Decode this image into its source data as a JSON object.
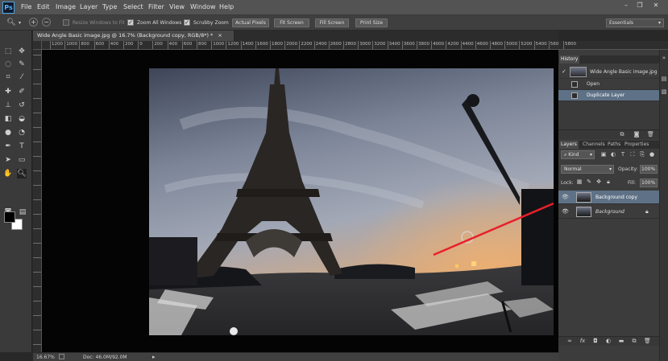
{
  "app": {
    "logo": "Ps"
  },
  "menu": [
    "File",
    "Edit",
    "Image",
    "Layer",
    "Type",
    "Select",
    "Filter",
    "View",
    "Window",
    "Help"
  ],
  "options": {
    "resize_windows": "Resize Windows to Fit",
    "zoom_all": "Zoom All Windows",
    "scrubby": "Scrubby Zoom",
    "actual_pixels": "Actual Pixels",
    "fit_screen": "Fit Screen",
    "fill_screen": "Fill Screen",
    "print_size": "Print Size",
    "workspace": "Essentials"
  },
  "document": {
    "tab_title": "Wide Angle Basic image.jpg @ 16.7% (Background copy, RGB/8*) *",
    "close": "×"
  },
  "ruler_labels": [
    "1200",
    "1000",
    "800",
    "600",
    "400",
    "200",
    "0",
    "200",
    "400",
    "600",
    "800",
    "1000",
    "1200",
    "1400",
    "1600",
    "1800",
    "2000",
    "2200",
    "2400",
    "2600",
    "2800",
    "3000",
    "3200",
    "3400",
    "3600",
    "3800",
    "4000",
    "4200",
    "4400",
    "4600",
    "4800",
    "5000",
    "5200",
    "5400",
    "5600",
    "5800"
  ],
  "status": {
    "zoom": "16.67%",
    "doc": "Doc: 46.0M/92.0M"
  },
  "history": {
    "tab": "History",
    "snapshot": "Wide Angle Basic image.jpg",
    "items": [
      "Open",
      "Duplicate Layer"
    ]
  },
  "layers_panel": {
    "tabs": [
      "Layers",
      "Channels",
      "Paths",
      "Properties"
    ],
    "kind": "Kind",
    "blend": "Normal",
    "opacity_label": "Opacity:",
    "opacity": "100%",
    "lock_label": "Lock:",
    "fill_label": "Fill:",
    "fill": "100%",
    "layers": [
      "Background copy",
      "Background"
    ]
  },
  "colors": {
    "accent": "#5e7186",
    "arrow": "#e8202a"
  }
}
